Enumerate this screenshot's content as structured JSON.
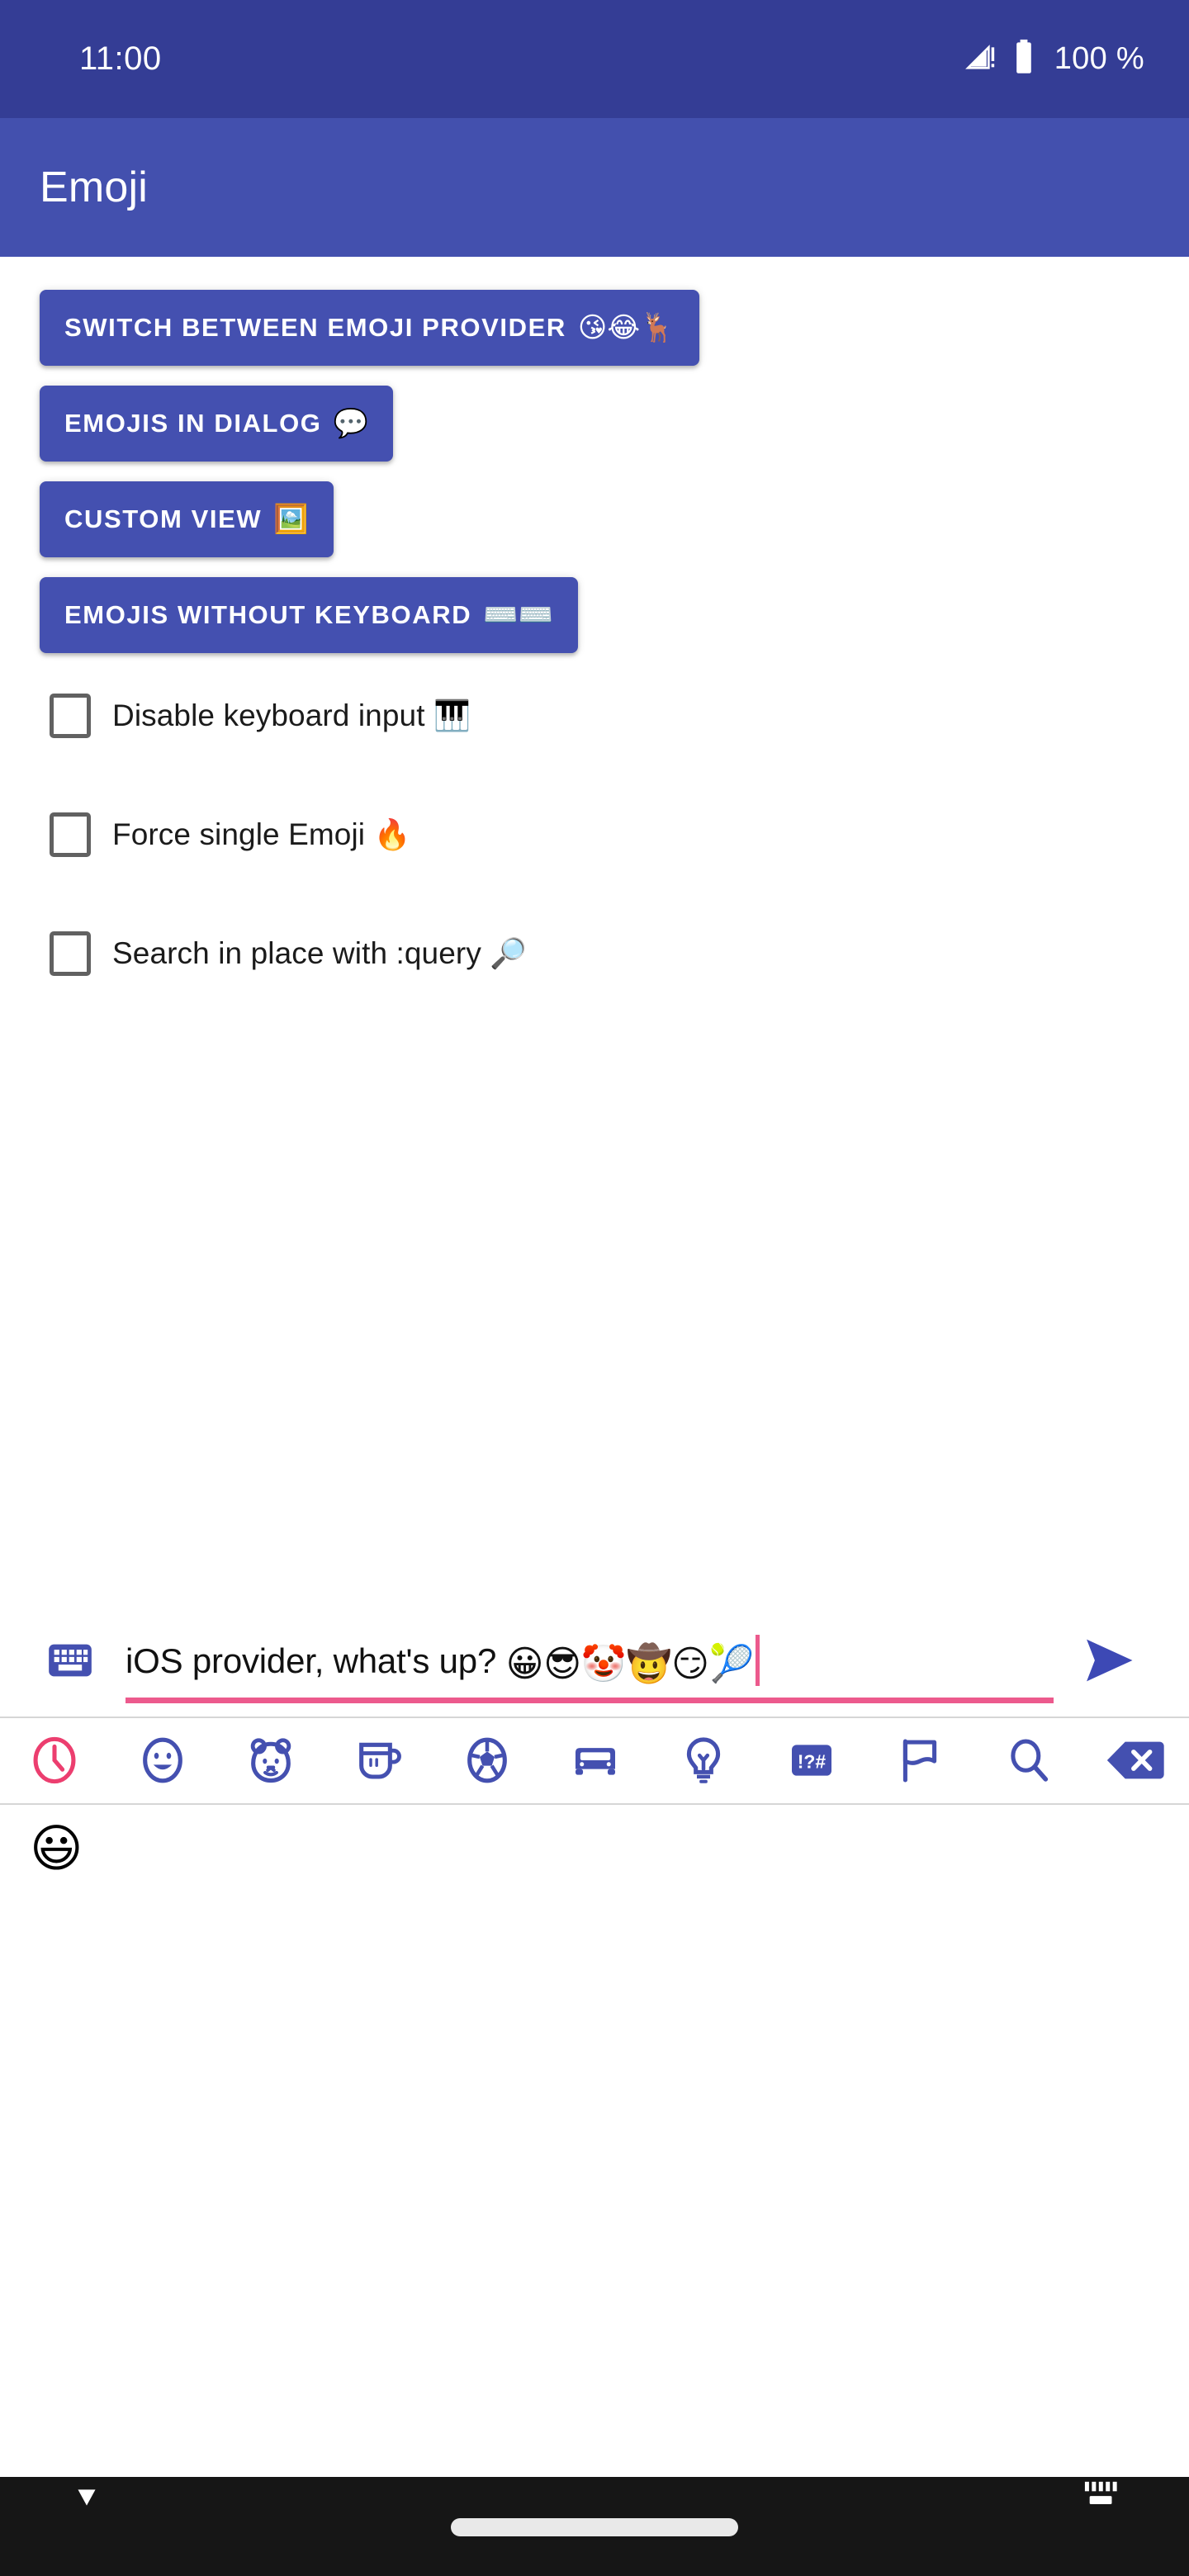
{
  "status_bar": {
    "time": "11:00",
    "battery_percent": "100 %",
    "signal_icon": "signal-no-sim-icon",
    "battery_icon": "battery-full-icon",
    "background_color": "#343D95"
  },
  "app_bar": {
    "title": "Emoji",
    "background_color": "#4350AE"
  },
  "buttons": [
    {
      "label": "SWITCH BETWEEN EMOJI PROVIDER",
      "emoji": "😘😂🦌",
      "name": "switch-emoji-provider-button"
    },
    {
      "label": "EMOJIS IN DIALOG",
      "emoji": "💬",
      "name": "emojis-in-dialog-button"
    },
    {
      "label": "CUSTOM VIEW",
      "emoji": "🖼️",
      "name": "custom-view-button"
    },
    {
      "label": "EMOJIS WITHOUT KEYBOARD",
      "emoji": "⌨️⌨️",
      "name": "emojis-without-keyboard-button"
    }
  ],
  "button_color": "#4450B0",
  "checkboxes": [
    {
      "label": "Disable keyboard input",
      "emoji": "🎹",
      "checked": false,
      "name": "disable-keyboard-input-checkbox"
    },
    {
      "label": "Force single Emoji",
      "emoji": "🔥",
      "checked": false,
      "name": "force-single-emoji-checkbox"
    },
    {
      "label": "Search in place with :query",
      "emoji": "🔎",
      "checked": false,
      "name": "search-in-place-checkbox"
    }
  ],
  "input_bar": {
    "keyboard_icon": "keyboard-icon",
    "text": "iOS provider, what's up? ",
    "emoji_text": "😀😎🤡🤠😏🎾",
    "placeholder": "",
    "send_icon": "send-icon",
    "underline_color": "#EC5A8D",
    "caret_color": "#EC5A8D"
  },
  "emoji_tabs": [
    {
      "name": "tab-recent",
      "icon": "clock-icon",
      "active": true
    },
    {
      "name": "tab-smileys",
      "icon": "smiley-icon",
      "active": false
    },
    {
      "name": "tab-animals",
      "icon": "bear-icon",
      "active": false
    },
    {
      "name": "tab-food",
      "icon": "cup-icon",
      "active": false
    },
    {
      "name": "tab-activity",
      "icon": "soccer-ball-icon",
      "active": false
    },
    {
      "name": "tab-travel",
      "icon": "car-icon",
      "active": false
    },
    {
      "name": "tab-objects",
      "icon": "lightbulb-icon",
      "active": false
    },
    {
      "name": "tab-symbols",
      "icon": "symbols-icon",
      "active": false
    },
    {
      "name": "tab-flags",
      "icon": "flag-icon",
      "active": false
    },
    {
      "name": "tab-search",
      "icon": "search-icon",
      "active": false
    },
    {
      "name": "tab-backspace",
      "icon": "backspace-icon",
      "active": false
    }
  ],
  "tab_active_color": "#EC3E6F",
  "tab_inactive_color": "#4450B0",
  "recent_emojis": [
    "😃"
  ],
  "nav_bar": {
    "background_color": "#161616",
    "hide_keyboard_icon": "chevron-down-icon",
    "switch_keyboard_icon": "keyboard-switch-icon",
    "gesture_pill": "home-gesture-pill"
  }
}
